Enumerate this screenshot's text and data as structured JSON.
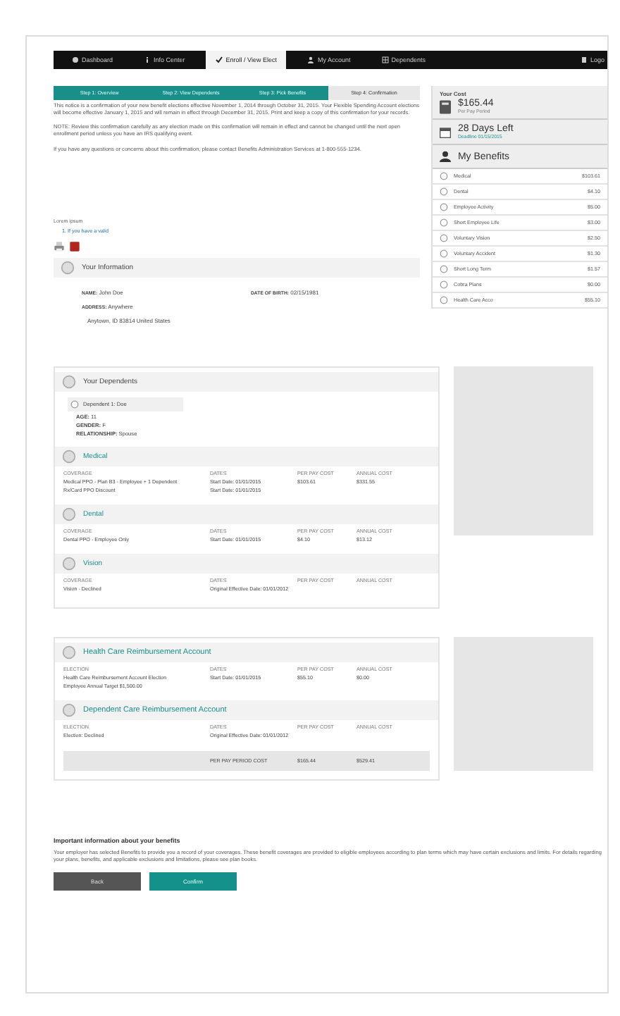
{
  "nav": [
    {
      "label": "Dashboard",
      "selected": false
    },
    {
      "label": "Info Center",
      "selected": false
    },
    {
      "label": "Enroll / View Elect",
      "selected": true
    },
    {
      "label": "My Account",
      "selected": false
    },
    {
      "label": "Dependents",
      "selected": false
    },
    {
      "label": "Logo",
      "selected": false
    }
  ],
  "steps": [
    {
      "label": "Step 1: Overview",
      "done": true
    },
    {
      "label": "Step 2: View Dependents",
      "done": true
    },
    {
      "label": "Step 3: Pick Benefits",
      "done": true
    },
    {
      "label": "Step 4: Confirmation",
      "done": false
    }
  ],
  "paragraphs": [
    "This notice is a confirmation of your new benefit elections effective November 1, 2014 through October 31, 2015. Your Flexible Spending Account elections will become effective January 1, 2015 and will remain in effect through December 31, 2015. Print and keep a copy of this confirmation for your records.",
    "NOTE: Review this confirmation carefully as any election made on this confirmation will remain in effect and cannot be changed until the next open enrollment period unless you have an IRS qualifying event.",
    "If you have any questions or concerns about this confirmation, please contact Benefits Administration Services at 1-800-555-1234."
  ],
  "attachments": {
    "label": "Lorem ipsum",
    "items": [
      "1. If you have a valid"
    ]
  },
  "your_information": {
    "title": "Your Information",
    "fields": [
      {
        "label": "NAME:",
        "value": "John Doe"
      },
      {
        "label": "DATE OF BIRTH:",
        "value": "02/15/1981"
      },
      {
        "label": "ADDRESS:",
        "value": "Anywhere"
      }
    ],
    "address_line": "Anytown, ID 83814 United States"
  },
  "sidebar": {
    "cost_label": "Your Cost",
    "cost": "$165.44",
    "cost_note": "Per Pay Period",
    "days": "28 Days Left",
    "deadline": "Deadline 01/15/2015",
    "benefits_title": "My Benefits",
    "benefits": [
      {
        "name": "Medical",
        "amount": "$103.61"
      },
      {
        "name": "Dental",
        "amount": "$4.10"
      },
      {
        "name": "Employee Activity",
        "amount": "$5.00"
      },
      {
        "name": "Short Employee Life",
        "amount": "$3.00"
      },
      {
        "name": "Voluntary Vision",
        "amount": "$2.50"
      },
      {
        "name": "Voluntary Accident",
        "amount": "$1.30"
      },
      {
        "name": "Short Long Term",
        "amount": "$1.57"
      },
      {
        "name": "Cobra Plans",
        "amount": "$0.00"
      },
      {
        "name": "Health Care Acco",
        "amount": "$55.10"
      }
    ]
  },
  "dependents": {
    "title": "Your Dependents",
    "people": [
      {
        "name": "Dependent 1: Doe",
        "fields": [
          {
            "label": "AGE:",
            "value": "11"
          },
          {
            "label": "GENDER:",
            "value": "F"
          },
          {
            "label": "RELATIONSHIP:",
            "value": "Spouse"
          }
        ]
      }
    ]
  },
  "plans": [
    {
      "title": "Medical",
      "columns": [
        "COVERAGE",
        "DATES",
        "PER PAY COST",
        "ANNUAL COST"
      ],
      "rows": [
        [
          "Medical PPO - Plan B3 - Employee + 1 Dependent",
          "Start Date: 01/01/2015",
          "$103.61",
          "$331.55"
        ],
        [
          "Rx/Card PPO Discount",
          "Start Date: 01/01/2015",
          "",
          ""
        ]
      ]
    },
    {
      "title": "Dental",
      "columns": [
        "COVERAGE",
        "DATES",
        "PER PAY COST",
        "ANNUAL COST"
      ],
      "rows": [
        [
          "Dental PPO - Employee Only",
          "Start Date: 01/01/2015",
          "$4.10",
          "$13.12"
        ]
      ]
    },
    {
      "title": "Vision",
      "columns": [
        "COVERAGE",
        "DATES",
        "PER PAY COST",
        "ANNUAL COST"
      ],
      "rows": [
        [
          "Vision - Declined",
          "Original Effective Date: 01/01/2012",
          "",
          ""
        ]
      ]
    }
  ],
  "accounts": [
    {
      "title": "Health Care Reimbursement Account",
      "columns": [
        "ELECTION",
        "DATES",
        "PER PAY COST",
        "ANNUAL COST"
      ],
      "rows": [
        [
          "Health Care Reimbursement Account Election",
          "Start Date: 01/01/2015",
          "$55.10",
          "$0.00"
        ],
        [
          "Employee Annual Target $1,500.00",
          "",
          "",
          ""
        ]
      ]
    },
    {
      "title": "Dependent Care Reimbursement Account",
      "columns": [
        "ELECTION",
        "DATES",
        "PER PAY COST",
        "ANNUAL COST"
      ],
      "rows": [
        [
          "Election: Declined",
          "Original Effective Date: 01/01/2012",
          "",
          ""
        ]
      ]
    }
  ],
  "total": {
    "label": "PER PAY PERIOD COST",
    "per_pay": "$165.44",
    "annual": "$529.41"
  },
  "important": {
    "title": "Important information about your benefits",
    "text": "Your employer has selected Benefits to provide you a record of your coverages. These benefit coverages are provided to eligible employees according to plan terms which may have certain exclusions and limits. For details regarding your plans, benefits, and applicable exclusions and limitations, please see plan books."
  },
  "buttons": [
    {
      "label": "Back",
      "kind": "secondary"
    },
    {
      "label": "Confirm",
      "kind": "primary"
    }
  ]
}
